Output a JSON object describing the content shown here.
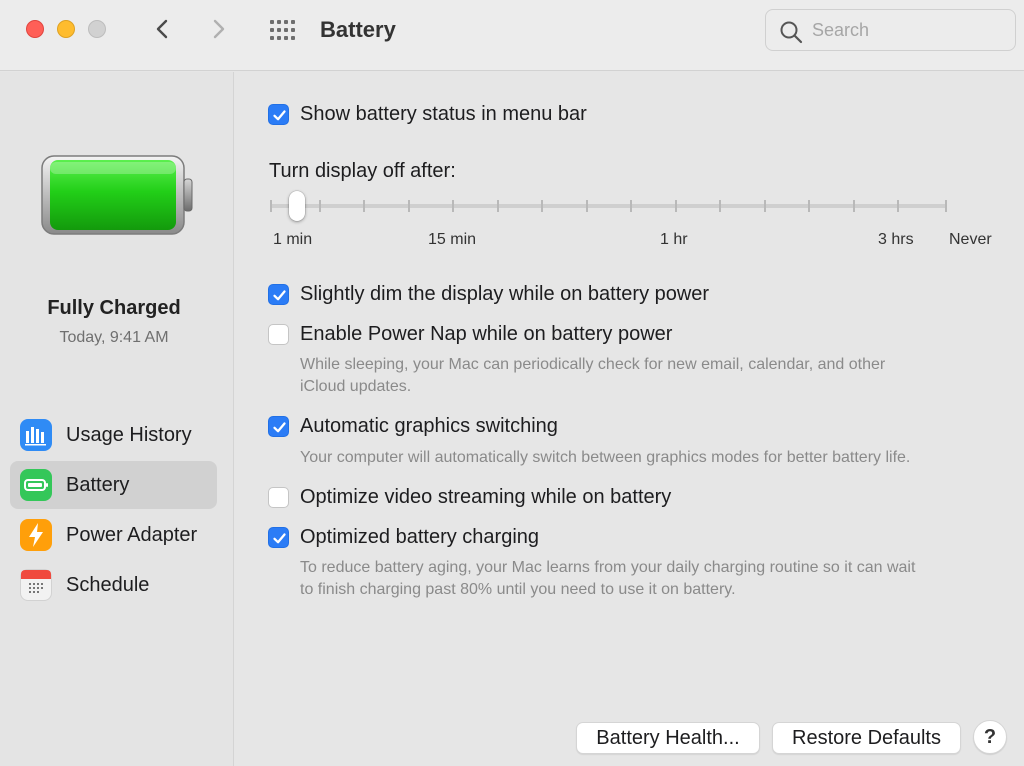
{
  "window": {
    "title": "Battery",
    "search_placeholder": "Search"
  },
  "sidebar": {
    "status_title": "Fully Charged",
    "status_time": "Today, 9:41 AM",
    "items": [
      {
        "label": "Usage History",
        "icon": "usage-history-icon"
      },
      {
        "label": "Battery",
        "icon": "battery-icon",
        "selected": true
      },
      {
        "label": "Power Adapter",
        "icon": "power-adapter-icon"
      },
      {
        "label": "Schedule",
        "icon": "schedule-icon"
      }
    ]
  },
  "settings": {
    "show_status": {
      "label": "Show battery status in menu bar",
      "checked": true
    },
    "display_off": {
      "label": "Turn display off after:",
      "tick_labels": [
        "1 min",
        "15 min",
        "1 hr",
        "3 hrs",
        "Never"
      ],
      "value": "1 min"
    },
    "dim_display": {
      "label": "Slightly dim the display while on battery power",
      "checked": true
    },
    "power_nap": {
      "label": "Enable Power Nap while on battery power",
      "checked": false,
      "desc_line1": "While sleeping, your Mac can periodically check for new email, calendar, and other",
      "desc_line2": "iCloud updates."
    },
    "auto_graphics": {
      "label": "Automatic graphics switching",
      "checked": true,
      "desc": "Your computer will automatically switch between graphics modes for better battery life."
    },
    "video_streaming": {
      "label": "Optimize video streaming while on battery",
      "checked": false
    },
    "optimized_charging": {
      "label": "Optimized battery charging",
      "checked": true,
      "desc_line1": "To reduce battery aging, your Mac learns from your daily charging routine so it can wait",
      "desc_line2": "to finish charging past 80% until you need to use it on battery."
    }
  },
  "buttons": {
    "battery_health": "Battery Health...",
    "restore_defaults": "Restore Defaults",
    "help": "?"
  },
  "colors": {
    "accent": "#2b7cf6",
    "battery_green": "#28d41f",
    "close": "#ff5f57",
    "minimize": "#febc2e"
  }
}
